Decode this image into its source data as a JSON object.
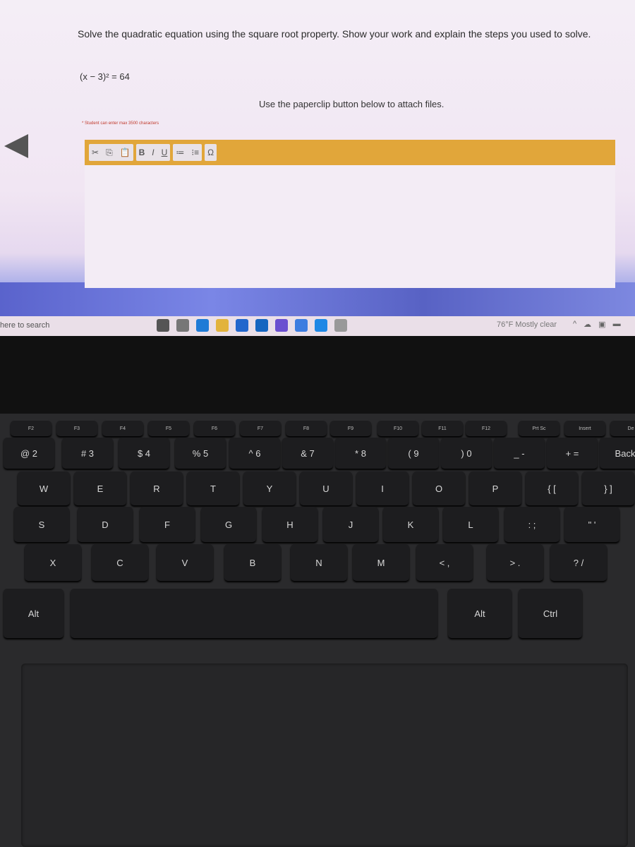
{
  "question": {
    "text": "Solve the quadratic equation using the square root property. Show your work and explain the steps you used to solve.",
    "equation": "(x − 3)² = 64",
    "attach_hint": "Use the paperclip button below to attach files.",
    "max_chars": "* Student can enter max 3500 characters"
  },
  "toolbar": {
    "cut": "✂",
    "copy": "⎘",
    "paste": "📋",
    "bold": "B",
    "italic": "I",
    "underline": "U",
    "ordered_list": "≔",
    "bullet_list": "⁝≡",
    "special_char": "Ω"
  },
  "taskbar": {
    "search": "here to search",
    "weather": "76°F  Mostly clear",
    "icons": [
      "cortana-icon",
      "task-view-icon",
      "edge-icon",
      "file-explorer-icon",
      "store-icon",
      "mail-icon",
      "app-icon",
      "chrome-icon",
      "app-icon",
      "settings-icon"
    ]
  },
  "keyboard": {
    "fn": [
      "F2",
      "F3",
      "F4",
      "F5",
      "F6",
      "F7",
      "F8",
      "F9",
      "F10",
      "F11",
      "F12",
      "Prt Sc",
      "Insert",
      "De"
    ],
    "numbers": [
      "@ 2",
      "# 3",
      "$ 4",
      "% 5",
      "^ 6",
      "& 7",
      "* 8",
      "( 9",
      ") 0",
      "_ -",
      "+ =",
      "Back"
    ],
    "top": [
      "W",
      "E",
      "R",
      "T",
      "Y",
      "U",
      "I",
      "O",
      "P",
      "{ [",
      "} ]"
    ],
    "home": [
      "S",
      "D",
      "F",
      "G",
      "H",
      "J",
      "K",
      "L",
      ": ;",
      "\" '"
    ],
    "bottom": [
      "X",
      "C",
      "V",
      "B",
      "N",
      "M",
      "< ,",
      "> .",
      "? /"
    ],
    "space": [
      "Alt",
      "",
      "Alt",
      "Ctrl"
    ]
  }
}
